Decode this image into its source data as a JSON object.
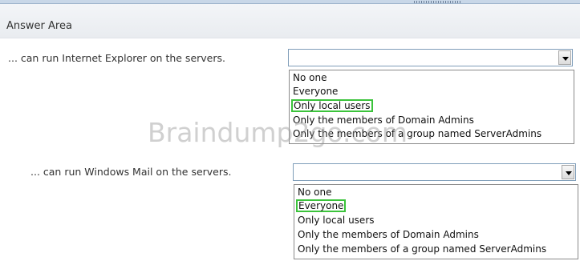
{
  "header": {
    "title": "Answer Area"
  },
  "questions": [
    {
      "prompt": "... can run Internet Explorer on the servers.",
      "options": [
        "No one",
        "Everyone",
        "Only local users",
        "Only the members of Domain Admins",
        "Only the members of a group named ServerAdmins"
      ],
      "selected": "Only local users"
    },
    {
      "prompt": "... can run Windows Mail on the servers.",
      "options": [
        "No one",
        "Everyone",
        "Only local users",
        "Only the members of Domain Admins",
        "Only the members of a group named ServerAdmins"
      ],
      "selected": "Everyone"
    }
  ],
  "watermark": "Braindump2go.com",
  "colors": {
    "selected_outline": "#3bc33b",
    "header_bg": "#eceff3"
  }
}
